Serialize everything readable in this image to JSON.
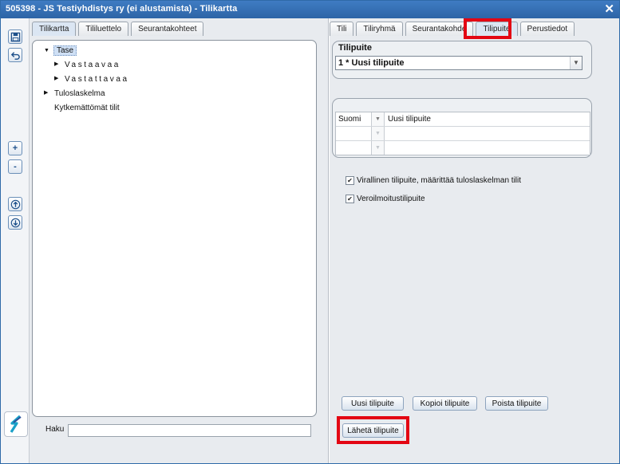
{
  "window": {
    "title": "505398 - JS Testiyhdistys ry (ei alustamista) - Tilikartta",
    "close": "✕"
  },
  "toolbar": {
    "add": "+",
    "remove": "-"
  },
  "left_tabs": [
    "Tilikartta",
    "Tililuettelo",
    "Seurantakohteet"
  ],
  "tree": {
    "tase": "Tase",
    "vastaavaa": "Vastaavaa",
    "vastattavaa": "Vastattavaa",
    "tuloslaskelma": "Tuloslaskelma",
    "kytkemattomat": "Kytkemättömät tilit"
  },
  "search": {
    "label": "Haku",
    "value": ""
  },
  "right_tabs": [
    "Tili",
    "Tiliryhmä",
    "Seurantakohde",
    "Tilipuite",
    "Perustiedot"
  ],
  "tilipuite": {
    "title": "Tilipuite",
    "selected": "1 * Uusi tilipuite",
    "names": [
      {
        "lang": "Suomi",
        "name": "Uusi tilipuite"
      },
      {
        "lang": "",
        "name": ""
      },
      {
        "lang": "",
        "name": ""
      }
    ]
  },
  "options": {
    "official": "Virallinen tilipuite, määrittää tuloslaskelman tilit",
    "official_checked": true,
    "tax": "Veroilmoitustilipuite",
    "tax_checked": true
  },
  "buttons": {
    "new": "Uusi tilipuite",
    "copy": "Kopioi tilipuite",
    "delete": "Poista tilipuite",
    "send": "Lähetä tilipuite"
  },
  "colors": {
    "titlebar": "#2f6aa8",
    "highlight": "#e30613",
    "selection": "#cfe0f5"
  }
}
